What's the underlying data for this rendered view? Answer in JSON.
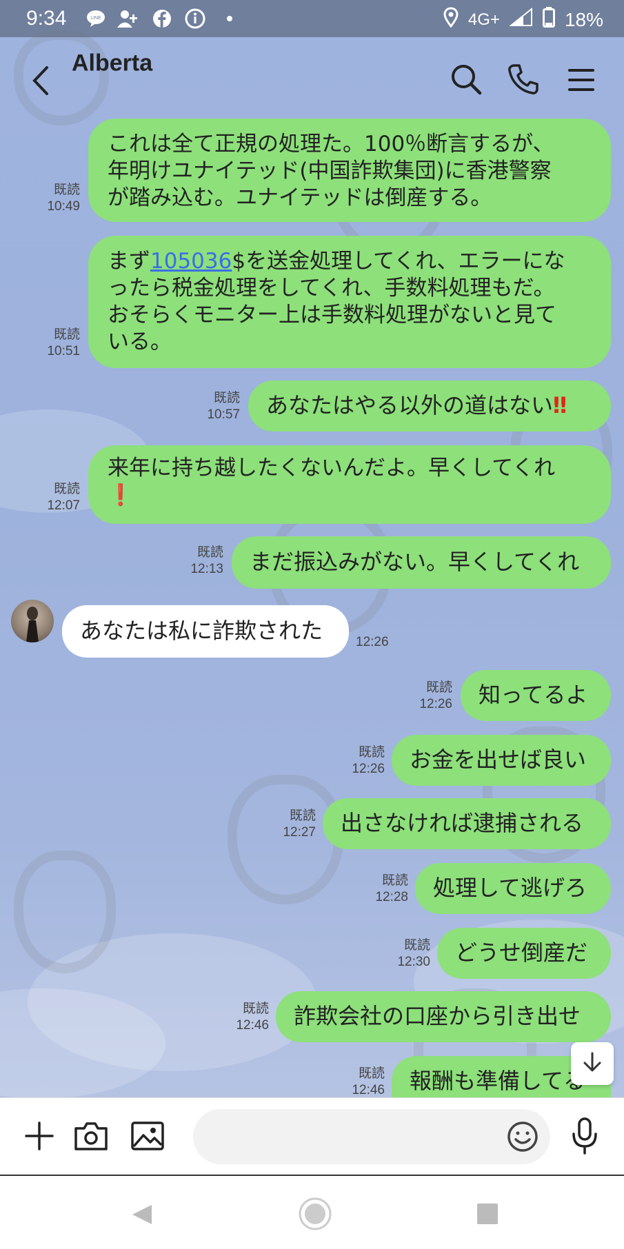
{
  "status_bar": {
    "time": "9:34",
    "network": "4G+",
    "battery": "18%",
    "notification_icons": [
      "line-icon",
      "add-contact-icon",
      "facebook-icon",
      "info-icon",
      "dot-icon"
    ]
  },
  "header": {
    "title": "Alberta"
  },
  "read_label": "既読",
  "messages": [
    {
      "side": "sent",
      "read": "既読",
      "time": "10:49",
      "lines": [
        "これは全て正規の処理た。100％断言するが、",
        "年明けユナイテッド(中国詐欺集団)に香港警察",
        "が踏み込む。ユナイテッドは倒産する。"
      ]
    },
    {
      "side": "sent",
      "read": "既読",
      "time": "10:51",
      "prefix": "まず",
      "link": "105036",
      "suffix": "$を送金処理してくれ、エラーにな",
      "lines": [
        "ったら税金処理をしてくれ、手数料処理もだ。",
        "おそらくモニター上は手数料処理がないと見て",
        "いる。"
      ]
    },
    {
      "side": "sent",
      "read": "既読",
      "time": "10:57",
      "text": "あなたはやる以外の道はない",
      "emoji": "‼"
    },
    {
      "side": "sent",
      "read": "既読",
      "time": "12:07",
      "text": "来年に持ち越したくないんだよ。早くしてくれ",
      "emoji": "❗"
    },
    {
      "side": "sent",
      "read": "既読",
      "time": "12:13",
      "text": "まだ振込みがない。早くしてくれ"
    },
    {
      "side": "received",
      "time": "12:26",
      "text": "あなたは私に詐欺された"
    },
    {
      "side": "sent",
      "read": "既読",
      "time": "12:26",
      "text": "知ってるよ"
    },
    {
      "side": "sent",
      "read": "既読",
      "time": "12:26",
      "text": "お金を出せば良い"
    },
    {
      "side": "sent",
      "read": "既読",
      "time": "12:27",
      "text": "出さなければ逮捕される"
    },
    {
      "side": "sent",
      "read": "既読",
      "time": "12:28",
      "text": "処理して逃げろ"
    },
    {
      "side": "sent",
      "read": "既読",
      "time": "12:30",
      "text": "どうせ倒産だ"
    },
    {
      "side": "sent",
      "read": "既読",
      "time": "12:46",
      "text": "詐欺会社の口座から引き出せ"
    },
    {
      "side": "sent",
      "read": "既読",
      "time": "12:46",
      "text": "報酬も準備してる"
    }
  ],
  "colors": {
    "sent_bubble": "#8de07a",
    "received_bubble": "#ffffff",
    "chat_background": "#9fb3df",
    "status_bar": "#6f7f9c"
  }
}
